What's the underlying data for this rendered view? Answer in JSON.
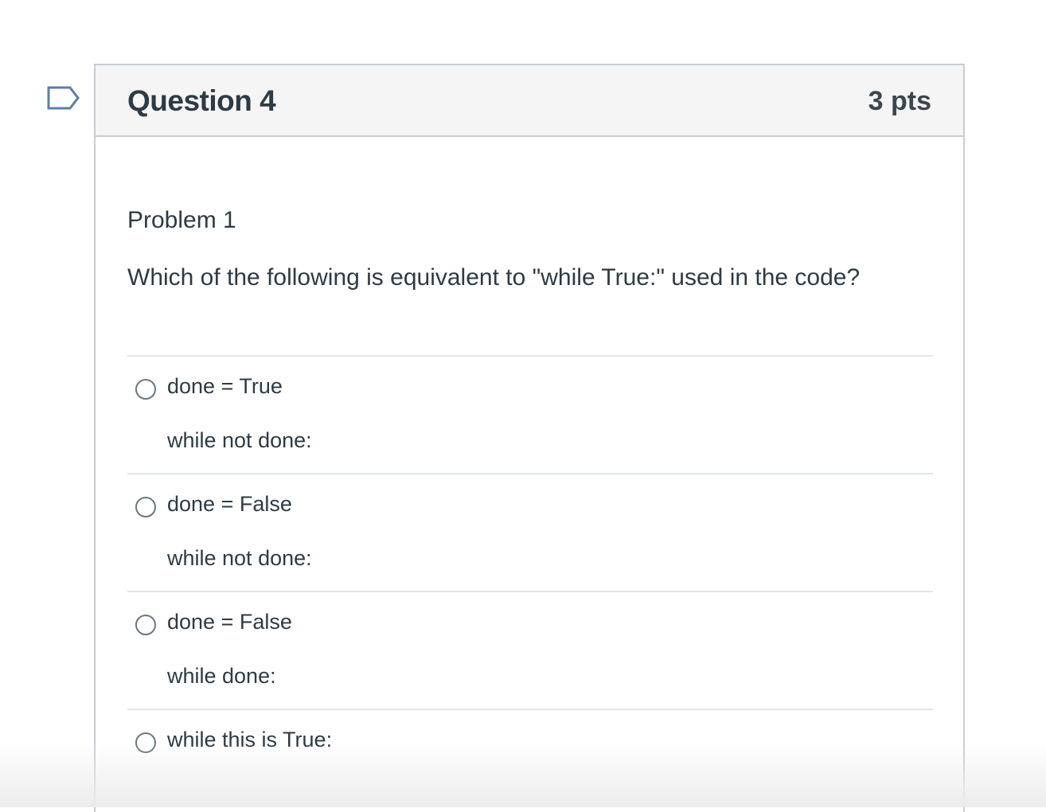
{
  "question": {
    "title": "Question 4",
    "points": "3 pts",
    "flag_icon": "flag-outline-icon",
    "problem_label": "Problem 1",
    "text": "Which of the following is equivalent to \"while True:\" used in the code?"
  },
  "answers": [
    {
      "line1": "done = True",
      "line2": "while not done:"
    },
    {
      "line1": "done = False",
      "line2": "while not done:"
    },
    {
      "line1": "done = False",
      "line2": "while done:"
    },
    {
      "line1": "while this is True:",
      "line2": ""
    }
  ],
  "colors": {
    "header_bg": "#f5f5f5",
    "border": "#c7cdd1",
    "text": "#2d3b45",
    "flag": "#5b7fa6"
  }
}
